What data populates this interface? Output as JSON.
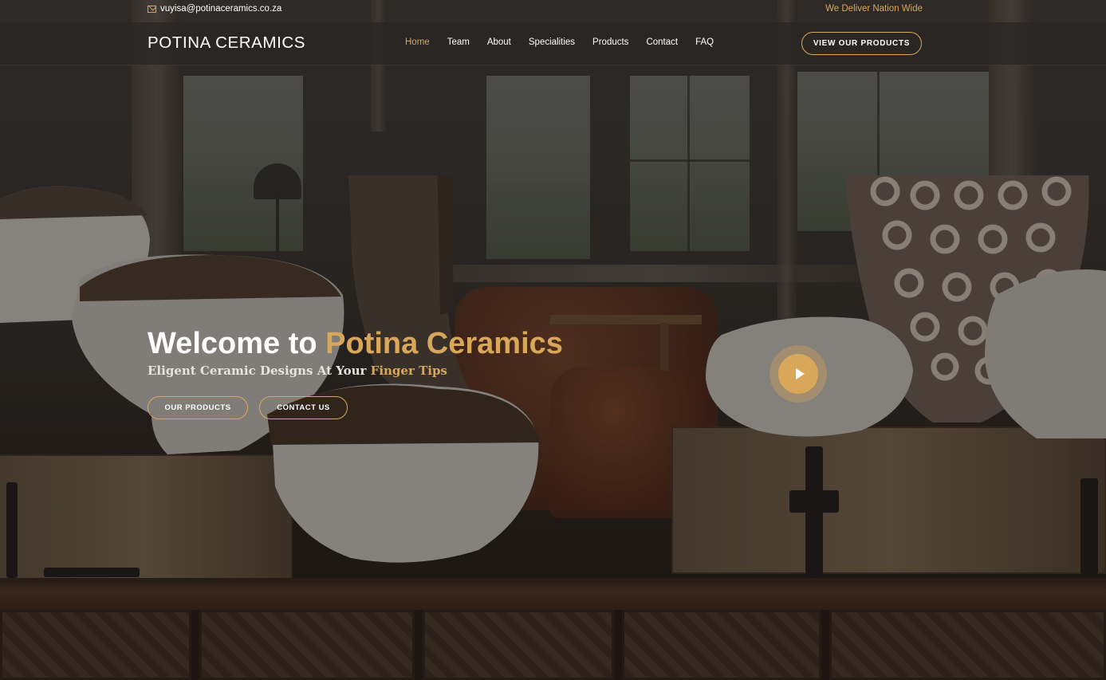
{
  "topbar": {
    "email": "vuyisa@potinaceramics.co.za",
    "delivery_note": "We Deliver Nation Wide"
  },
  "nav": {
    "logo": "POTINA CERAMICS",
    "items": [
      {
        "label": "Home",
        "active": true
      },
      {
        "label": "Team"
      },
      {
        "label": "About"
      },
      {
        "label": "Specialities"
      },
      {
        "label": "Products"
      },
      {
        "label": "Contact"
      },
      {
        "label": "FAQ"
      }
    ],
    "cta_label": "VIEW OUR PRODUCTS"
  },
  "hero": {
    "title_prefix": "Welcome to ",
    "title_accent": "Potina Ceramics",
    "subtitle_prefix": "Eligent Ceramic Designs At Your ",
    "subtitle_accent": "Finger Tips",
    "primary_button": "OUR PRODUCTS",
    "secondary_button": "CONTACT US"
  },
  "colors": {
    "accent": "#d9a75a",
    "nav_background": "#282623"
  },
  "icons": {
    "email": "mail-icon",
    "video": "play-icon"
  }
}
